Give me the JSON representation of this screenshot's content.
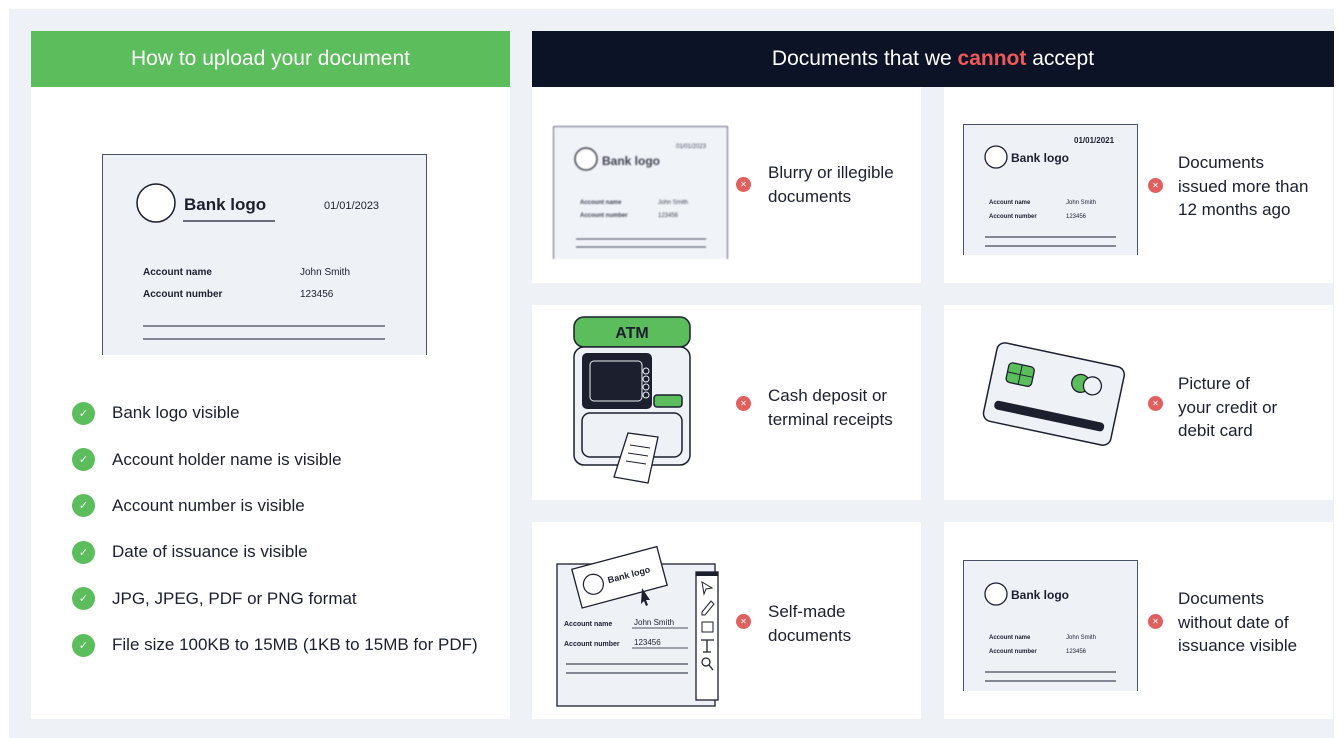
{
  "left": {
    "header": "How to upload your document",
    "sample_doc": {
      "logo": "Bank logo",
      "date": "01/01/2023",
      "account_name_label": "Account name",
      "account_name_value": "John Smith",
      "account_number_label": "Account number",
      "account_number_value": "123456"
    },
    "checklist": [
      "Bank logo visible",
      "Account holder name is visible",
      "Account number is visible",
      "Date of issuance is visible",
      "JPG, JPEG, PDF or PNG format",
      "File size 100KB to 15MB (1KB to 15MB for PDF)"
    ]
  },
  "right": {
    "header_before": "Documents that we ",
    "header_highlight": "cannot",
    "header_after": " accept",
    "cards": [
      {
        "label": "Blurry or illegible\ndocuments",
        "doc": {
          "logo": "Bank logo",
          "date": "01/01/2023",
          "account_name_label": "Account name",
          "account_name_value": "John Smith",
          "account_number_label": "Account number",
          "account_number_value": "123456"
        }
      },
      {
        "label": "Documents\nissued more than\n12 months ago",
        "doc": {
          "logo": "Bank logo",
          "date": "01/01/2021",
          "account_name_label": "Account name",
          "account_name_value": "John Smith",
          "account_number_label": "Account number",
          "account_number_value": "123456"
        }
      },
      {
        "label": "Cash deposit or\nterminal receipts",
        "atm": "ATM"
      },
      {
        "label": "Picture of\nyour credit or\ndebit card"
      },
      {
        "label": "Self-made\ndocuments",
        "doc": {
          "logo": "Bank logo",
          "account_name_label": "Account name",
          "account_name_value": "John Smith",
          "account_number_label": "Account number",
          "account_number_value": "123456"
        }
      },
      {
        "label": "Documents\nwithout date of\nissuance visible",
        "doc": {
          "logo": "Bank logo",
          "account_name_label": "Account name",
          "account_name_value": "John Smith",
          "account_number_label": "Account number",
          "account_number_value": "123456"
        }
      }
    ]
  },
  "colors": {
    "green": "#5cbd5c",
    "navy": "#0c1327",
    "red": "#ee5a5a",
    "background": "#eef1f6"
  },
  "icons": {
    "check": "check-icon",
    "reject": "x-icon"
  }
}
